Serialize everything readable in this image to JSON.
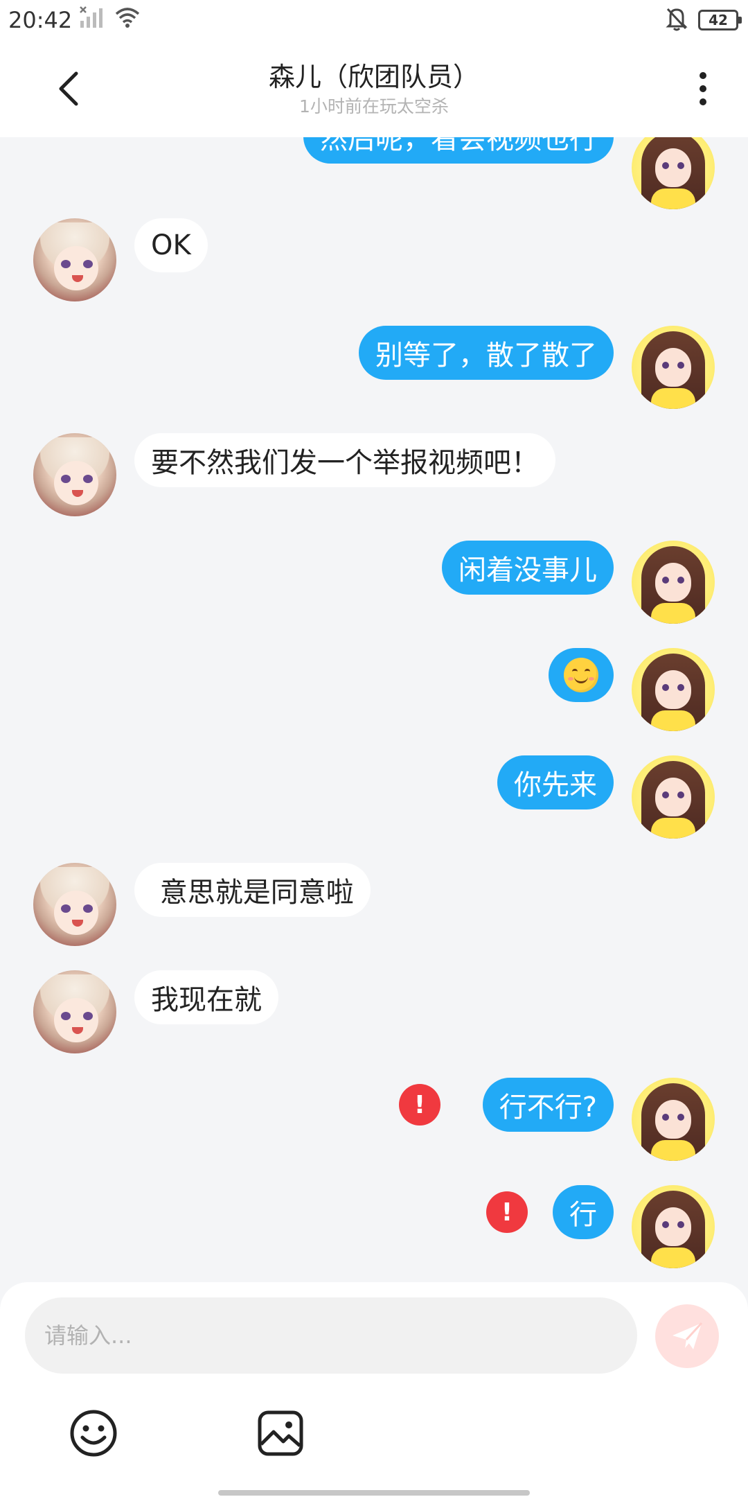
{
  "status_bar": {
    "time": "20:42",
    "battery": "42"
  },
  "header": {
    "title": "森儿（欣团队员）",
    "subtitle": "1小时前在玩太空杀"
  },
  "messages": [
    {
      "side": "right",
      "text": "然后呢，看会视频也行",
      "error": false
    },
    {
      "side": "left",
      "text": "OK",
      "error": false
    },
    {
      "side": "right",
      "text": "别等了，散了散了",
      "error": false
    },
    {
      "side": "left",
      "text": "要不然我们发一个举报视频吧！",
      "error": false
    },
    {
      "side": "right",
      "text": "闲着没事儿",
      "error": false
    },
    {
      "side": "right",
      "text": "",
      "emoji": "smiling-face",
      "error": false
    },
    {
      "side": "right",
      "text": "你先来",
      "error": false
    },
    {
      "side": "left",
      "text": " 意思就是同意啦",
      "error": false
    },
    {
      "side": "left",
      "text": "我现在就",
      "error": false
    },
    {
      "side": "right",
      "text": "行不行?",
      "error": true
    },
    {
      "side": "right",
      "text": "行",
      "error": true
    }
  ],
  "composer": {
    "placeholder": "请输入..."
  },
  "colors": {
    "outgoing_bubble": "#22aaf6",
    "incoming_bubble": "#ffffff",
    "error": "#f0393f",
    "send_button": "#ffe0de"
  }
}
